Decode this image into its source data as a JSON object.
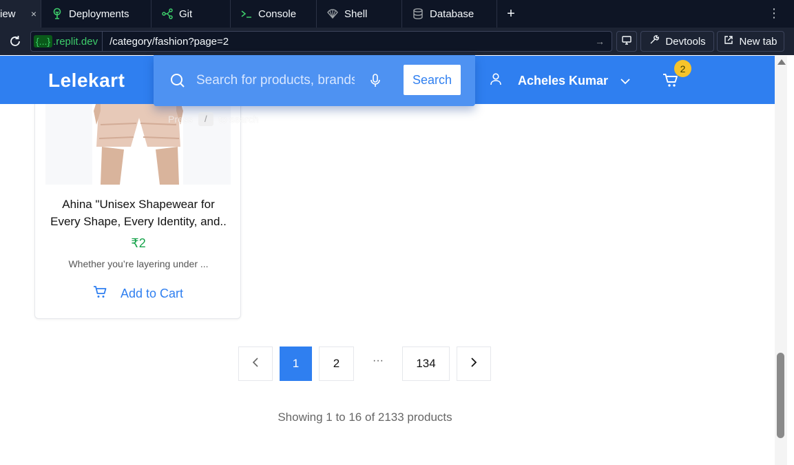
{
  "ide": {
    "tabs": [
      {
        "label": "iew",
        "icon": "webview-icon"
      },
      {
        "label": "Deployments",
        "icon": "deployments-icon"
      },
      {
        "label": "Git",
        "icon": "git-icon"
      },
      {
        "label": "Console",
        "icon": "console-icon"
      },
      {
        "label": "Shell",
        "icon": "shell-icon"
      },
      {
        "label": "Database",
        "icon": "database-icon"
      }
    ],
    "close_glyph": "×",
    "plus_glyph": "+",
    "kebab_glyph": "⋮"
  },
  "address": {
    "domain_braces": "{...}",
    "domain": ".replit.dev",
    "path": "/category/fashion?page=2",
    "devtools_label": "Devtools",
    "newtab_label": "New tab"
  },
  "header": {
    "logo": "Lelekart",
    "search_placeholder": "Search for products, brands and more",
    "search_button": "Search",
    "press_hint_pre": "Press",
    "press_hint_key": "/",
    "press_hint_post": "to search",
    "user_name": "Acheles Kumar",
    "cart_count": "2",
    "accent_color": "#2f7ff0"
  },
  "product": {
    "title": "Ahina \"Unisex Shapewear for Every Shape, Every Identity, and..",
    "price": "₹2",
    "description": "Whether you’re layering under ...",
    "add_to_cart": "Add to Cart"
  },
  "pagination": {
    "pages": [
      "1",
      "2",
      "134"
    ],
    "current": "1",
    "ellipsis": "···",
    "summary": "Showing 1 to 16 of 2133 products"
  }
}
